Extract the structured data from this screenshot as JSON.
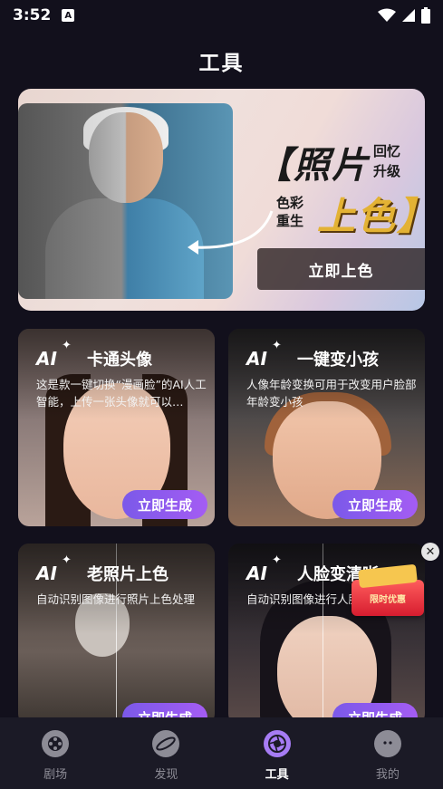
{
  "status_bar": {
    "time": "3:52",
    "notify_glyph": "A"
  },
  "page": {
    "title": "工具"
  },
  "banner": {
    "title_main": "【照片",
    "title_sub_top": "回忆升级",
    "title_sub_left": "色彩重生",
    "title_accent": "上色】",
    "button_label": "立即上色"
  },
  "tools": [
    {
      "ai_label": "AI",
      "title": "卡通头像",
      "desc": "这是款一键切换“漫画脸”的AI人工智能，上传一张头像就可以…",
      "button": "立即生成"
    },
    {
      "ai_label": "AI",
      "title": "一键变小孩",
      "desc": "人像年龄变换可用于改变用户脸部年龄变小孩",
      "button": "立即生成"
    },
    {
      "ai_label": "AI",
      "title": "老照片上色",
      "desc": "自动识别图像进行照片上色处理",
      "button": "立即生成"
    },
    {
      "ai_label": "AI",
      "title": "人脸变清晰",
      "desc": "自动识别图像进行人脸清晰处理",
      "button": "立即生成"
    }
  ],
  "promo": {
    "label": "限时优惠"
  },
  "bottom_nav": [
    {
      "label": "剧场",
      "icon": "film-reel-icon"
    },
    {
      "label": "发现",
      "icon": "planet-icon"
    },
    {
      "label": "工具",
      "icon": "aperture-icon",
      "active": true
    },
    {
      "label": "我的",
      "icon": "profile-face-icon"
    }
  ],
  "colors": {
    "accent": "#a67cf4",
    "button_gradient_start": "#7b59e9",
    "button_gradient_end": "#a45cf3",
    "background": "#12101c"
  }
}
